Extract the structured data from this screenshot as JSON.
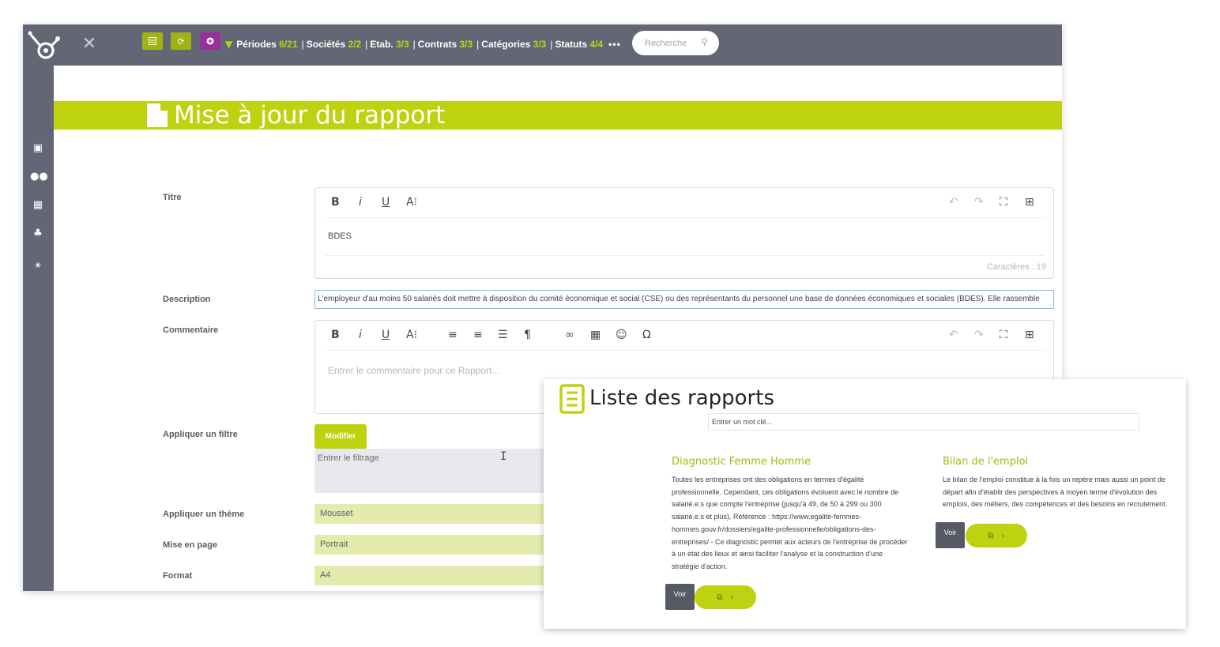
{
  "topbar": {
    "filters": [
      {
        "label": "Périodes",
        "count": "6/21"
      },
      {
        "label": "Sociétés",
        "count": "2/2"
      },
      {
        "label": "Etab.",
        "count": "3/3"
      },
      {
        "label": "Contrats",
        "count": "3/3"
      },
      {
        "label": "Catégories",
        "count": "3/3"
      },
      {
        "label": "Statuts",
        "count": "4/4"
      }
    ],
    "separator": "|",
    "more": "•••",
    "search_placeholder": "Recherche"
  },
  "page": {
    "title": "Mise à jour du rapport"
  },
  "form": {
    "titre_label": "Titre",
    "titre_value": "BDES",
    "char_count": "Caractères : 19",
    "description_label": "Description",
    "description_value": "L'employeur d'au moins 50 salariés doit mettre à disposition du comité économique et social (CSE) ou des représentants du personnel une base de données économiques et sociales (BDES). Elle rassemble",
    "commentaire_label": "Commentaire",
    "commentaire_placeholder": "Entrer le commentaire pour ce Rapport...",
    "filtre_label": "Appliquer un filtre",
    "modifier_label": "Modifier",
    "filtrage_placeholder": "Entrer le filtrage",
    "theme_label": "Appliquer un thème",
    "theme_value": "Mousset",
    "mise_en_page_label": "Mise en page",
    "mise_en_page_value": "Portrait",
    "format_label": "Format",
    "format_value": "A4"
  },
  "editor_toolbar": {
    "bold": "B",
    "italic": "i",
    "underline": "U",
    "font_size": "A⁝"
  },
  "rapports": {
    "title": "Liste des rapports",
    "keyword_placeholder": "Entrer un mot clé...",
    "items": [
      {
        "title": "Diagnostic Femme Homme",
        "text": "Toutes les entreprises ont des obligations en termes d'égalité professionnelle. Cependant, ces obligations évoluent avec le nombre de salarié.e.s que compte l'entreprise (jusqu'à 49, de 50 à 299 ou 300 salarié.e.s et plus). Référence : https://www.egalite-femmes-hommes.gouv.fr/dossiers/egalite-professionnelle/obligations-des-entreprises/ - Ce diagnostic permet aux acteurs de l'entreprise de procéder à un état des lieux et ainsi faciliter l'analyse et la construction d'une stratégie d'action.",
        "voir": "Voir"
      },
      {
        "title": "Bilan de l'emploi",
        "text": "Le bilan de l'emploi constitue à la fois un repère mais aussi un point de départ afin d'établir des perspectives à moyen terme d'évolution des emplois, des métiers, des compétences et des besoins en recrutement.",
        "voir": "Voir"
      }
    ]
  },
  "colors": {
    "accent": "#bfd20f",
    "chrome": "#636775",
    "purple": "#9b2f9a"
  }
}
